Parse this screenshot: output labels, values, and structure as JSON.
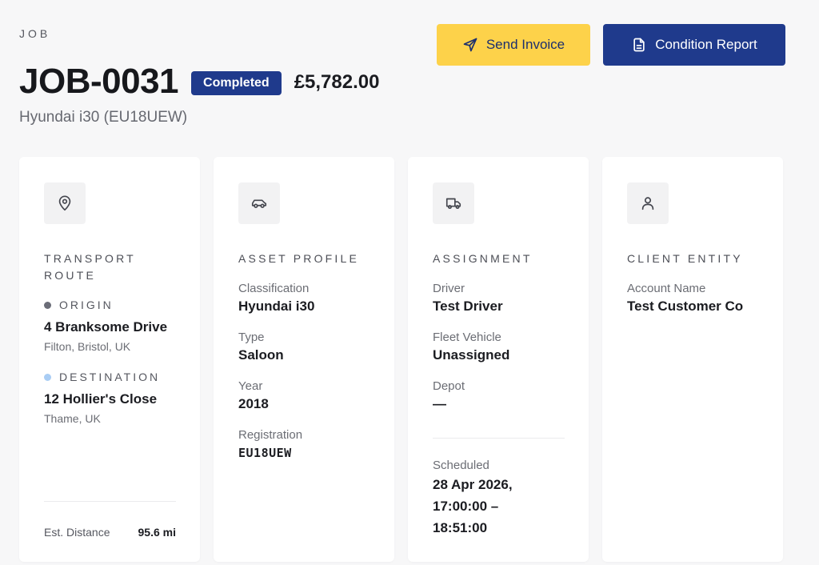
{
  "header": {
    "eyebrow": "JOB",
    "job_id": "JOB-0031",
    "status": "Completed",
    "amount": "£5,782.00",
    "vehicle": "Hyundai i30 (EU18UEW)"
  },
  "actions": {
    "send_invoice": "Send Invoice",
    "condition_report": "Condition Report"
  },
  "route": {
    "title": "TRANSPORT ROUTE",
    "origin_label": "ORIGIN",
    "origin_line1": "4 Branksome Drive",
    "origin_line2": "Filton, Bristol, UK",
    "destination_label": "DESTINATION",
    "destination_line1": "12 Hollier's Close",
    "destination_line2": "Thame, UK",
    "distance_label": "Est. Distance",
    "distance_value": "95.6 mi"
  },
  "asset": {
    "title": "ASSET PROFILE",
    "classification_label": "Classification",
    "classification_value": "Hyundai i30",
    "type_label": "Type",
    "type_value": "Saloon",
    "year_label": "Year",
    "year_value": "2018",
    "registration_label": "Registration",
    "registration_value": "EU18UEW"
  },
  "assignment": {
    "title": "ASSIGNMENT",
    "driver_label": "Driver",
    "driver_value": "Test Driver",
    "fleet_label": "Fleet Vehicle",
    "fleet_value": "Unassigned",
    "depot_label": "Depot",
    "depot_value": "—",
    "scheduled_label": "Scheduled",
    "scheduled_line1": "28 Apr 2026,",
    "scheduled_line2": "17:00:00 –",
    "scheduled_line3": "18:51:00"
  },
  "client": {
    "title": "CLIENT ENTITY",
    "account_label": "Account Name",
    "account_value": "Test Customer Co"
  },
  "colors": {
    "primary": "#1f3a8c",
    "accent": "#fdd24a",
    "origin_dot": "#6b6d78",
    "destination_dot": "#a9cdf4"
  },
  "icons": {
    "send_invoice": "send-icon",
    "condition_report": "document-icon",
    "route": "map-pin-icon",
    "asset": "car-icon",
    "assignment": "truck-icon",
    "client": "user-icon"
  }
}
